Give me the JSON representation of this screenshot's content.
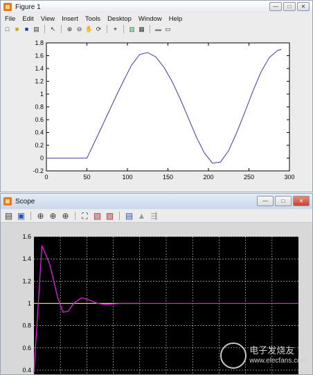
{
  "figure": {
    "title": "Figure 1",
    "menu": [
      "File",
      "Edit",
      "View",
      "Insert",
      "Tools",
      "Desktop",
      "Window",
      "Help"
    ],
    "toolbar_icons": [
      "new-file-icon",
      "open-folder-icon",
      "save-icon",
      "print-icon",
      "pointer-icon",
      "zoom-in-icon",
      "zoom-out-icon",
      "pan-icon",
      "rotate-icon",
      "data-cursor-icon",
      "colorbar-icon",
      "legend-icon",
      "hide-tools-icon",
      "show-tools-icon"
    ],
    "window_buttons": [
      "—",
      "□",
      "✕"
    ]
  },
  "scope": {
    "title": "Scope",
    "toolbar_icons": [
      "print-icon",
      "parameters-icon",
      "zoom-icon",
      "zoom-x-icon",
      "zoom-y-icon",
      "autoscale-icon",
      "save-axes-icon",
      "restore-axes-icon",
      "floating-scope-icon",
      "lock-icon",
      "signal-selection-icon"
    ],
    "window_buttons": [
      "—",
      "□",
      "✕"
    ]
  },
  "colors": {
    "figure_line": "#4a4aa8",
    "scope_bg": "#000000",
    "scope_grid": "#ffffff",
    "scope_signal": "#e020e0",
    "scope_reference": "#e8e060"
  },
  "chart_data": [
    {
      "type": "line",
      "x_ticks": [
        0,
        50,
        100,
        150,
        200,
        250,
        300
      ],
      "y_ticks": [
        -0.2,
        0,
        0.2,
        0.4,
        0.6,
        0.8,
        1,
        1.2,
        1.4,
        1.6,
        1.8
      ],
      "xlim": [
        0,
        300
      ],
      "ylim": [
        -0.2,
        1.8
      ],
      "grid": false,
      "series": [
        {
          "x": [
            0,
            50,
            55,
            65,
            75,
            85,
            95,
            105,
            115,
            125,
            135,
            145,
            155,
            165,
            175,
            185,
            195,
            205,
            215,
            225,
            235,
            245,
            255,
            265,
            275,
            285,
            290
          ],
          "values": [
            0,
            0,
            0.13,
            0.4,
            0.67,
            0.94,
            1.2,
            1.45,
            1.62,
            1.65,
            1.58,
            1.42,
            1.2,
            0.93,
            0.63,
            0.33,
            0.08,
            -0.08,
            -0.06,
            0.12,
            0.4,
            0.72,
            1.05,
            1.35,
            1.57,
            1.68,
            1.7
          ]
        }
      ]
    },
    {
      "type": "line",
      "y_ticks": [
        0.4,
        0.6,
        0.8,
        1,
        1.2,
        1.4,
        1.6
      ],
      "ylim": [
        0.35,
        1.6
      ],
      "xlim": [
        0,
        10
      ],
      "grid": true,
      "series": [
        {
          "x": [
            0,
            0.3,
            0.6,
            0.9,
            1.1,
            1.3,
            1.5,
            1.8,
            2.1,
            2.4,
            2.7,
            3.0,
            3.3,
            3.6,
            4,
            5,
            6,
            7,
            8,
            9,
            10
          ],
          "values": [
            0.38,
            1.52,
            1.35,
            1.05,
            0.92,
            0.93,
            1.0,
            1.05,
            1.03,
            1.0,
            0.99,
            0.995,
            1.0,
            1.0,
            1.0,
            1.0,
            1.0,
            1.0,
            1.0,
            1.0,
            1.0
          ]
        },
        {
          "x": [
            0,
            4
          ],
          "values": [
            1.0,
            1.0
          ]
        }
      ]
    }
  ],
  "watermark": {
    "line1": "电子发烧友",
    "line2": "www.elecfans.com"
  }
}
